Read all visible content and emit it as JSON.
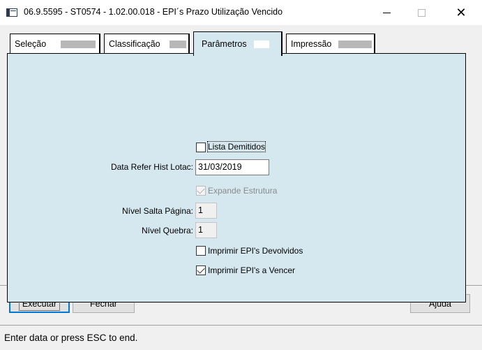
{
  "window": {
    "title": "06.9.5595 - ST0574 - 1.02.00.018 - EPI´s Prazo Utilização Vencido",
    "icon": "app-window-icon",
    "controls": {
      "minimize": "minimize-icon",
      "maximize": "maximize-icon",
      "close": "close-icon"
    }
  },
  "tabs": [
    {
      "label": "Seleção",
      "active": false
    },
    {
      "label": "Classificação",
      "active": false
    },
    {
      "label": "Parâmetros",
      "active": true
    },
    {
      "label": "Impressão",
      "active": false
    }
  ],
  "form": {
    "lista_demitidos": {
      "label": "Lista Demitidos",
      "checked": false
    },
    "data_refer": {
      "label": "Data Refer Hist Lotac:",
      "value": "31/03/2019"
    },
    "expande_estrutura": {
      "label": "Expande Estrutura",
      "checked": true,
      "disabled": true
    },
    "nivel_salta_pagina": {
      "label": "Nível Salta Página:",
      "value": "1"
    },
    "nivel_quebra": {
      "label": "Nível Quebra:",
      "value": "1"
    },
    "imprimir_devolvidos": {
      "label": "Imprimir EPI's Devolvidos",
      "checked": false
    },
    "imprimir_vencer": {
      "label": "Imprimir EPI's a Vencer",
      "checked": true
    }
  },
  "buttons": {
    "executar": "Executar",
    "fechar": "Fechar",
    "ajuda": "Ajuda"
  },
  "status": "Enter data or press ESC to end.",
  "colors": {
    "panel": "#d6e8ef",
    "default_button_border": "#0078d7"
  }
}
